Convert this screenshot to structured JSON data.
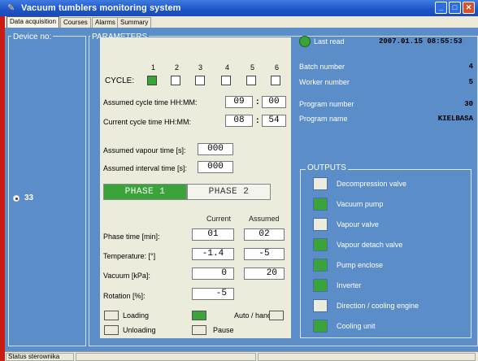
{
  "window": {
    "title": "Vacuum tumblers monitoring system",
    "min_glyph": "_",
    "max_glyph": "□",
    "close_glyph": "✕"
  },
  "tabs": [
    "Data acquisition",
    "Courses",
    "Alarms",
    "Summary"
  ],
  "device": {
    "label": "Device no:",
    "selected": "33"
  },
  "parameters": {
    "label": "PARAMETERS",
    "cycle_label": "CYCLE:",
    "cycles": [
      {
        "num": "1",
        "on": true
      },
      {
        "num": "2",
        "on": false
      },
      {
        "num": "3",
        "on": false
      },
      {
        "num": "4",
        "on": false
      },
      {
        "num": "5",
        "on": false
      },
      {
        "num": "6",
        "on": false
      }
    ],
    "assumed_cycle_label": "Assumed cycle time HH:MM:",
    "assumed_cycle_hh": "09",
    "assumed_cycle_mm": "00",
    "current_cycle_label": "Current cycle time HH:MM:",
    "current_cycle_hh": "08",
    "current_cycle_mm": "54",
    "vapour_label": "Assumed vapour time [s]:",
    "vapour_value": "000",
    "interval_label": "Assumed interval time [s]:",
    "interval_value": "000",
    "phase1": "PHASE 1",
    "phase2": "PHASE 2",
    "col_current": "Current",
    "col_assumed": "Assumed",
    "phase_time_label": "Phase time [min]:",
    "phase_time_current": "01",
    "phase_time_assumed": "02",
    "temperature_label": "Temperature: [°]",
    "temperature_current": "-1.4",
    "temperature_assumed": "-5",
    "vacuum_label": "Vacuum [kPa]:",
    "vacuum_current": "0",
    "vacuum_assumed": "20",
    "rotation_label": "Rotation [%]:",
    "rotation_current": "-5",
    "loading": "Loading",
    "unloading": "Unloading",
    "auto_hand": "Auto / hand",
    "pause": "Pause"
  },
  "info": {
    "last_read_label": "Last read",
    "last_read_value": "2007.01.15 08:55:53",
    "batch_label": "Batch number",
    "batch_value": "4",
    "worker_label": "Worker number",
    "worker_value": "5",
    "program_num_label": "Program number",
    "program_num_value": "30",
    "program_name_label": "Program name",
    "program_name_value": "KIELBASA"
  },
  "outputs": {
    "label": "OUTPUTS",
    "items": [
      {
        "label": "Decompression valve",
        "on": false
      },
      {
        "label": "Vacuum pump",
        "on": true
      },
      {
        "label": "Vapour valve",
        "on": false
      },
      {
        "label": "Vapour detach valve",
        "on": true
      },
      {
        "label": "Pump enclose",
        "on": true
      },
      {
        "label": "Inverter",
        "on": true
      },
      {
        "label": "Direction / cooling engine",
        "on": false
      },
      {
        "label": "Cooling unit",
        "on": true
      }
    ]
  },
  "status": {
    "label": "Status sterownika"
  },
  "colors": {
    "titlebar": "#1d54c9",
    "background": "#5b8ec9",
    "active": "#3aa33a",
    "panel": "#ececdc"
  }
}
